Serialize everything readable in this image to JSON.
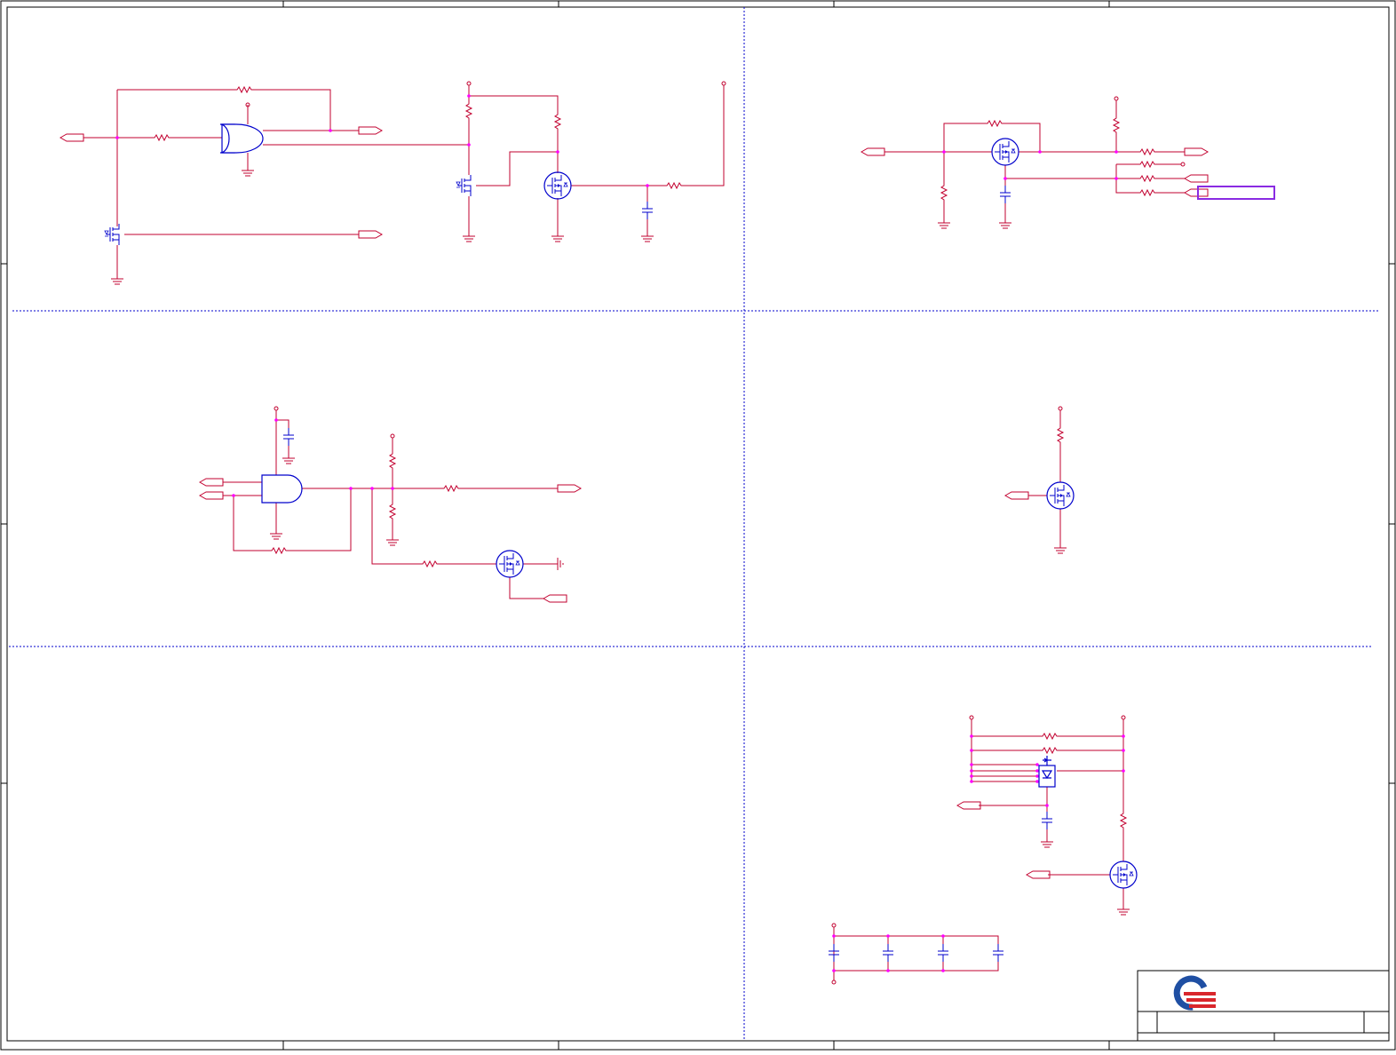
{
  "document": {
    "type": "schematic",
    "panel_count": 6
  },
  "colors": {
    "wire": "#c2002f",
    "connection": "#ff00ff",
    "component": "#0000cc",
    "highlight": "#8a2be2",
    "frame": "#000000",
    "divider": "#0000cc",
    "logo_blue": "#1f4fa3",
    "logo_red": "#d9262c"
  },
  "icons": {
    "logo": "company-logo-icon",
    "mosfet": "mosfet-icon",
    "resistor": "resistor-icon",
    "capacitor": "capacitor-icon",
    "ground": "ground-icon",
    "port": "offpage-port-icon",
    "gate": "and-gate-icon"
  },
  "title_block": {
    "logo_present": true
  }
}
